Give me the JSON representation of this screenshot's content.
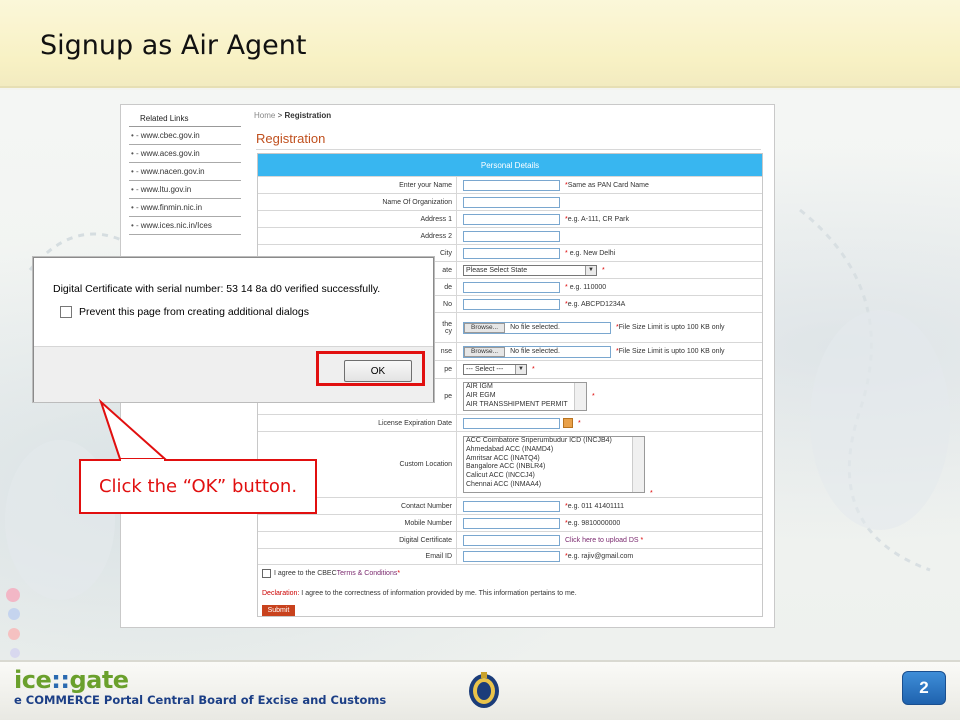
{
  "slide": {
    "title": "Signup as Air Agent",
    "page_number": "2",
    "footer_logo": {
      "part1": "ice",
      "separator": "::",
      "part2": "gate"
    },
    "footer_subtitle": "e COMMERCE Portal Central Board of Excise and Customs"
  },
  "callout": {
    "text": "Click the “OK” button."
  },
  "dialog": {
    "message": "Digital Certificate with serial number: 53 14 8a d0 verified successfully.",
    "checkbox_label": "Prevent this page from creating additional dialogs",
    "ok_label": "OK"
  },
  "site": {
    "related_links": {
      "title": "Related Links",
      "items": [
        "www.cbec.gov.in",
        "www.aces.gov.in",
        "www.nacen.gov.in",
        "www.ltu.gov.in",
        "www.finmin.nic.in",
        "www.ices.nic.in/Ices"
      ]
    },
    "breadcrumb": {
      "home": "Home",
      "separator": ">",
      "current": "Registration"
    },
    "page_title": "Registration",
    "form": {
      "section_title": "Personal Details",
      "fields": {
        "name": {
          "label": "Enter your Name",
          "hint": "Same as PAN Card Name"
        },
        "organization": {
          "label": "Name Of Organization"
        },
        "address1": {
          "label": "Address 1",
          "hint": "e.g. A-111, CR Park"
        },
        "address2": {
          "label": "Address 2"
        },
        "city": {
          "label": "City",
          "hint": "e.g. New Delhi"
        },
        "state": {
          "label": "ate",
          "value": "Please Select State"
        },
        "pincode": {
          "label": "de",
          "hint": "e.g. 110000"
        },
        "pan": {
          "label": "No",
          "hint": "e.g. ABCPD1234A"
        },
        "file1": {
          "label_line1": "the",
          "label_line2": "cy",
          "button": "Browse...",
          "status": "No file selected.",
          "hint": "File Size Limit is upto 100 KB only"
        },
        "file2": {
          "label": "nse",
          "button": "Browse...",
          "status": "No file selected.",
          "hint": "File Size Limit is upto 100 KB only"
        },
        "type": {
          "label": "pe",
          "value": "--- Select ---"
        },
        "license_type": {
          "label": "pe",
          "options": [
            "AIR IGM",
            "AIR EGM",
            "AIR TRANSSHIPMENT PERMIT"
          ]
        },
        "license_expiry": {
          "label": "License Expiration Date"
        },
        "custom_location": {
          "label": "Custom Location",
          "options": [
            "ACC Coimbatore Sriperumbudur ICD (INCJB4)",
            "Ahmedabad ACC (INAMD4)",
            "Amritsar ACC (INATQ4)",
            "Bangalore ACC (INBLR4)",
            "Calicut ACC (INCCJ4)",
            "Chennai ACC (INMAA4)"
          ]
        },
        "contact": {
          "label": "Contact Number",
          "hint": "e.g. 011 41401111"
        },
        "mobile": {
          "label": "Mobile Number",
          "hint": "e.g. 9810000000"
        },
        "digital_cert": {
          "label": "Digital Certificate",
          "link": "Click here to upload DS"
        },
        "email": {
          "label": "Email ID",
          "hint": "e.g. rajiv@gmail.com"
        }
      },
      "agree": {
        "prefix": "I agree to the CBEC ",
        "terms": "Terms & Conditions",
        "suffix": "*"
      },
      "declaration": {
        "label": "Declaration:",
        "text": " I agree to the correctness of information provided by me. This information pertains to me."
      },
      "submit_label": "Submit"
    }
  },
  "colors": {
    "accent_red": "#e10f0f",
    "header_blue": "#38b6f0",
    "title_orange": "#c0501e"
  }
}
